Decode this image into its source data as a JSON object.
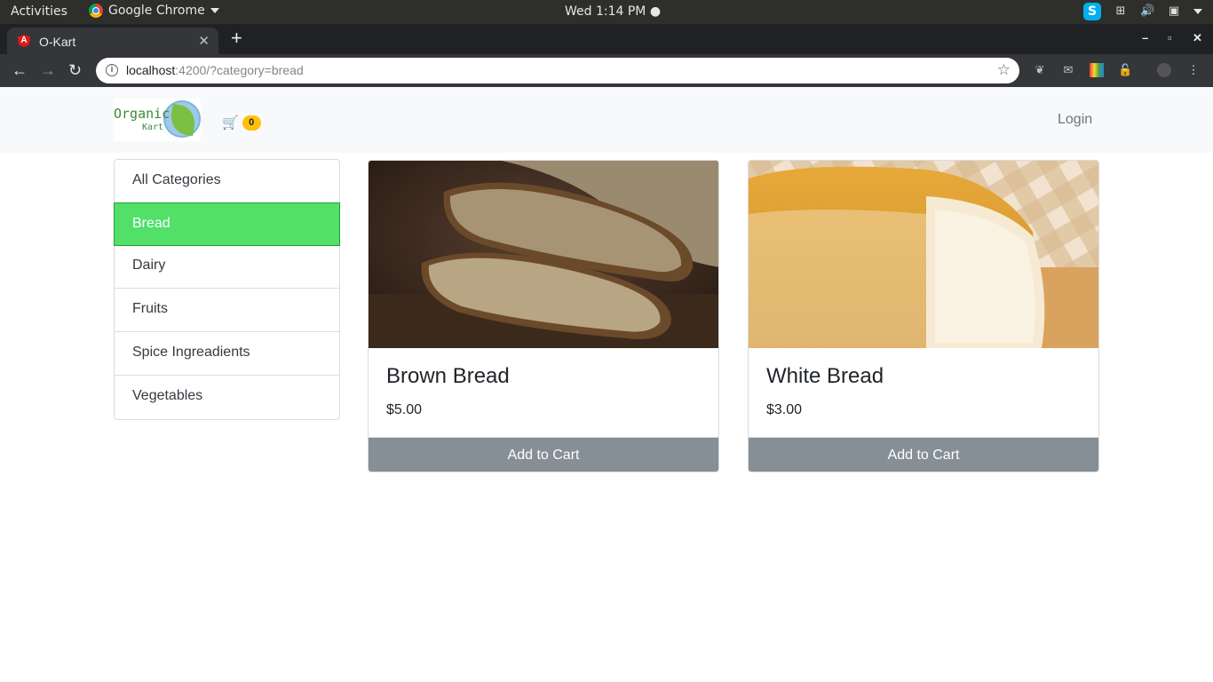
{
  "os_bar": {
    "activities": "Activities",
    "app_name": "Google Chrome",
    "clock": "Wed  1:14 PM"
  },
  "browser": {
    "tab_title": "O-Kart",
    "favicon_letter": "A",
    "url_host": "localhost",
    "url_rest": ":4200/?category=bread"
  },
  "navbar": {
    "logo_line1": "Organic",
    "logo_line2": "Kart",
    "cart_count": "0",
    "login_label": "Login"
  },
  "categories": {
    "items": [
      {
        "label": "All Categories",
        "active": false
      },
      {
        "label": "Bread",
        "active": true
      },
      {
        "label": "Dairy",
        "active": false
      },
      {
        "label": "Fruits",
        "active": false
      },
      {
        "label": "Spice Ingreadients",
        "active": false
      },
      {
        "label": "Vegetables",
        "active": false
      }
    ]
  },
  "products": [
    {
      "name": "Brown Bread",
      "price": "$5.00",
      "button": "Add to Cart"
    },
    {
      "name": "White Bread",
      "price": "$3.00",
      "button": "Add to Cart"
    }
  ],
  "colors": {
    "active_category": "#52e069",
    "add_to_cart": "#868e96",
    "cart_badge": "#ffc107"
  }
}
